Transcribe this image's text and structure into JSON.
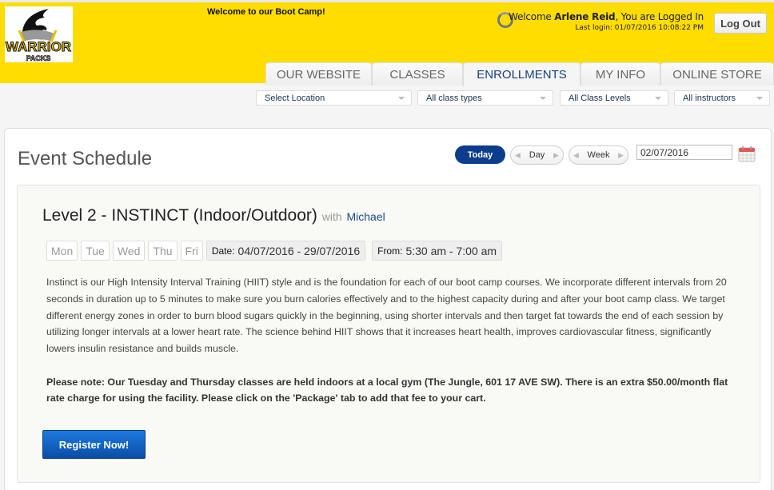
{
  "header": {
    "logo_alt": "Warrior Packs",
    "welcome_banner": "Welcome to our Boot Camp!",
    "user": {
      "welcome_prefix": "Welcome ",
      "name": "Arlene Reid",
      "welcome_suffix": ", You are Logged In",
      "last_login": "Last login: 01/07/2016 10:08:22 PM"
    },
    "logout_label": "Log Out",
    "brand_color": "#ffdd00"
  },
  "tabs": [
    {
      "label": "OUR WEBSITE",
      "active": false
    },
    {
      "label": "CLASSES",
      "active": false
    },
    {
      "label": "ENROLLMENTS",
      "active": true
    },
    {
      "label": "MY INFO",
      "active": false
    },
    {
      "label": "ONLINE STORE",
      "active": false
    }
  ],
  "filters": {
    "location": "Select Location",
    "class_type": "All class types",
    "class_level": "All Class Levels",
    "instructor": "All instructors"
  },
  "schedule": {
    "title": "Event Schedule",
    "today_label": "Today",
    "day_label": "Day",
    "week_label": "Week",
    "date_value": "02/07/2016"
  },
  "event": {
    "title": "Level 2 - INSTINCT (Indoor/Outdoor)",
    "with_label": "with",
    "instructor": "Michael",
    "days": [
      "Mon",
      "Tue",
      "Wed",
      "Thu",
      "Fri"
    ],
    "date_label": "Date:",
    "date_range": "04/07/2016 - 29/07/2016",
    "time_label": "From:",
    "time_range": "5:30 am - 7:00 am",
    "description": "Instinct is our High Intensity Interval Training (HIIT) style and is the foundation for each of our boot camp courses. We incorporate different intervals from 20 seconds in duration up to 5 minutes to make sure you burn calories effectively and to the highest capacity during and after your boot camp class. We target different energy zones in order to burn blood sugars quickly in the beginning, using shorter intervals and then target fat towards the end of each session by utilizing longer intervals at a lower heart rate. The science behind HIIT shows that it increases heart health, improves cardiovascular fitness, significantly lowers insulin resistance and builds muscle.",
    "note": "Please note:  Our Tuesday and Thursday classes are held indoors at a local gym (The Jungle, 601 17 AVE SW).  There is an extra $50.00/month flat rate charge for using the facility.  Please click on the 'Package' tab to add that fee to your cart.",
    "register_label": "Register Now!"
  }
}
